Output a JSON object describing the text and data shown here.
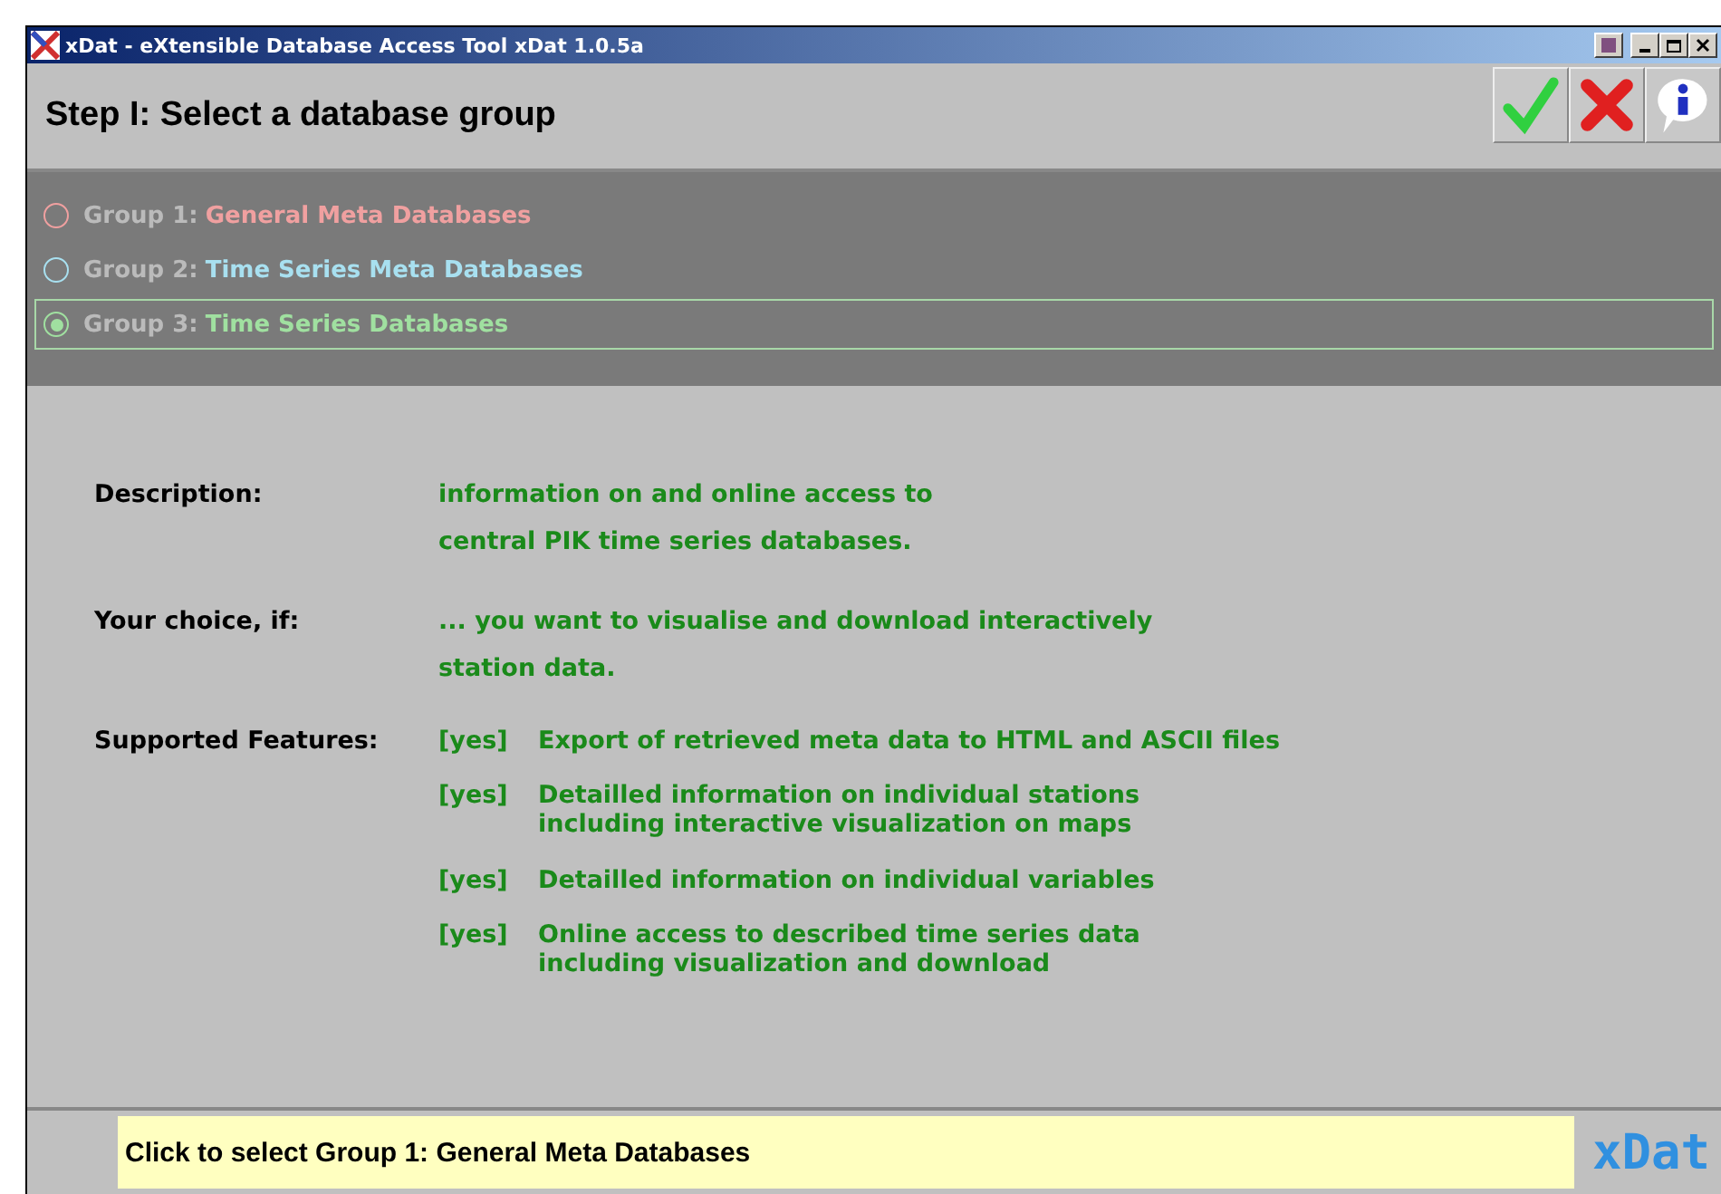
{
  "window": {
    "title": "xDat - eXtensible Database Access Tool xDat 1.0.5a"
  },
  "header": {
    "title": "Step I: Select a database group"
  },
  "groups": [
    {
      "prefix": "Group 1:",
      "name": "General Meta Databases",
      "color": "#f0a0a0",
      "selected": false
    },
    {
      "prefix": "Group 2:",
      "name": "Time Series Meta Databases",
      "color": "#a8e0f0",
      "selected": false
    },
    {
      "prefix": "Group 3:",
      "name": "Time Series Databases",
      "color": "#a0e0a0",
      "selected": true
    }
  ],
  "details": [
    {
      "label": "Description:",
      "lines": [
        "information on and online access to",
        "central PIK time series databases."
      ]
    },
    {
      "label": "Your choice, if:",
      "lines": [
        "... you want to visualise and download interactively",
        "station data."
      ]
    }
  ],
  "features": {
    "label": "Supported Features:",
    "items": [
      {
        "tag": "[yes]",
        "lines": [
          "Export of retrieved meta data to HTML and ASCII files"
        ]
      },
      {
        "tag": "[yes]",
        "lines": [
          "Detailled information on individual stations",
          "including interactive visualization on maps"
        ]
      },
      {
        "tag": "[yes]",
        "lines": [
          "Detailled information on individual variables"
        ]
      },
      {
        "tag": "[yes]",
        "lines": [
          "Online access to described time series data",
          "including visualization and download"
        ]
      }
    ]
  },
  "status_bar": {
    "message": "Click to select Group 1: General Meta Databases",
    "logo": "xDat"
  }
}
